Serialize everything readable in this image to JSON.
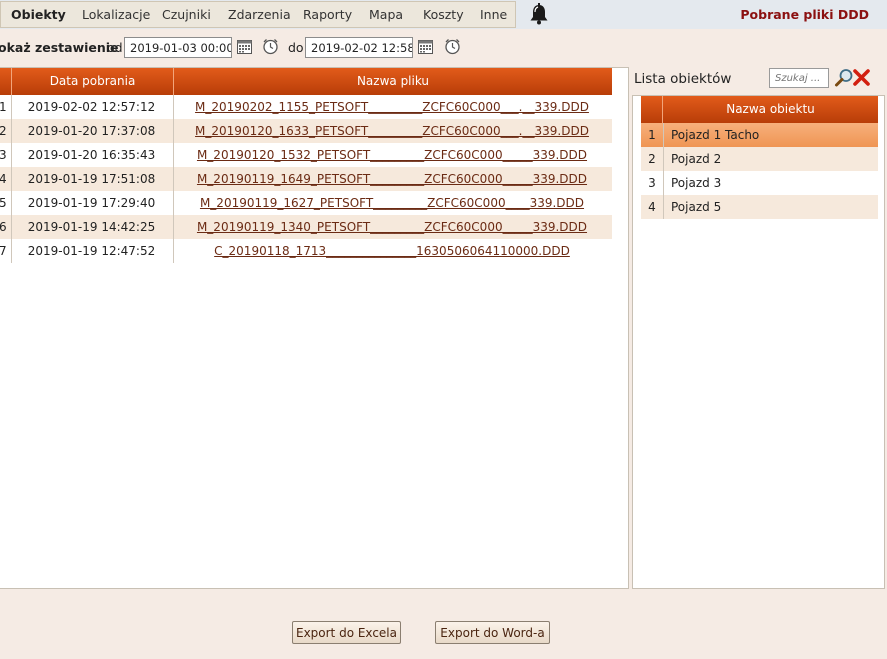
{
  "menu": {
    "items": [
      {
        "label": "Obiekty",
        "active": true
      },
      {
        "label": "Lokalizacje"
      },
      {
        "label": "Czujniki"
      },
      {
        "label": "Zdarzenia"
      },
      {
        "label": "Raporty"
      },
      {
        "label": "Mapa"
      },
      {
        "label": "Koszty"
      },
      {
        "label": "Inne"
      }
    ],
    "bell_icon": "bell-icon"
  },
  "page_title": "Pobrane pliki DDD",
  "filter": {
    "label_bold": "okaż zestawienie",
    "from_label": "od",
    "from_value": "2019-01-03 00:00",
    "to_label": "do",
    "to_value": "2019-02-02 12:58"
  },
  "files_table": {
    "columns": [
      "Data pobrania",
      "Nazwa pliku"
    ],
    "rows": [
      {
        "n": "1",
        "date": "2019-02-02 12:57:12",
        "file": "M_20190202_1155_PETSOFT_________ZCFC60C000___.__339.DDD"
      },
      {
        "n": "2",
        "date": "2019-01-20 17:37:08",
        "file": "M_20190120_1633_PETSOFT_________ZCFC60C000___.__339.DDD"
      },
      {
        "n": "3",
        "date": "2019-01-20 16:35:43",
        "file": "M_20190120_1532_PETSOFT_________ZCFC60C000_____339.DDD"
      },
      {
        "n": "4",
        "date": "2019-01-19 17:51:08",
        "file": "M_20190119_1649_PETSOFT_________ZCFC60C000_____339.DDD"
      },
      {
        "n": "5",
        "date": "2019-01-19 17:29:40",
        "file": "M_20190119_1627_PETSOFT_________ZCFC60C000____339.DDD"
      },
      {
        "n": "6",
        "date": "2019-01-19 14:42:25",
        "file": "M_20190119_1340_PETSOFT_________ZCFC60C000_____339.DDD"
      },
      {
        "n": "7",
        "date": "2019-01-19 12:47:52",
        "file": "C_20190118_1713_______________1630506064110000.DDD"
      }
    ]
  },
  "objects": {
    "title": "Lista obiektów",
    "search_placeholder": "Szukaj ...",
    "column": "Nazwa obiektu",
    "rows": [
      {
        "n": "1",
        "name": "Pojazd 1 Tacho",
        "selected": true
      },
      {
        "n": "2",
        "name": "Pojazd 2"
      },
      {
        "n": "3",
        "name": "Pojazd 3"
      },
      {
        "n": "4",
        "name": "Pojazd 5"
      }
    ]
  },
  "export": {
    "excel_label": "Export do Excela",
    "word_label": "Export do Word-a"
  },
  "colors": {
    "accent": "#c8470d",
    "title": "#8b1010",
    "selected_row": "#f2a066"
  }
}
